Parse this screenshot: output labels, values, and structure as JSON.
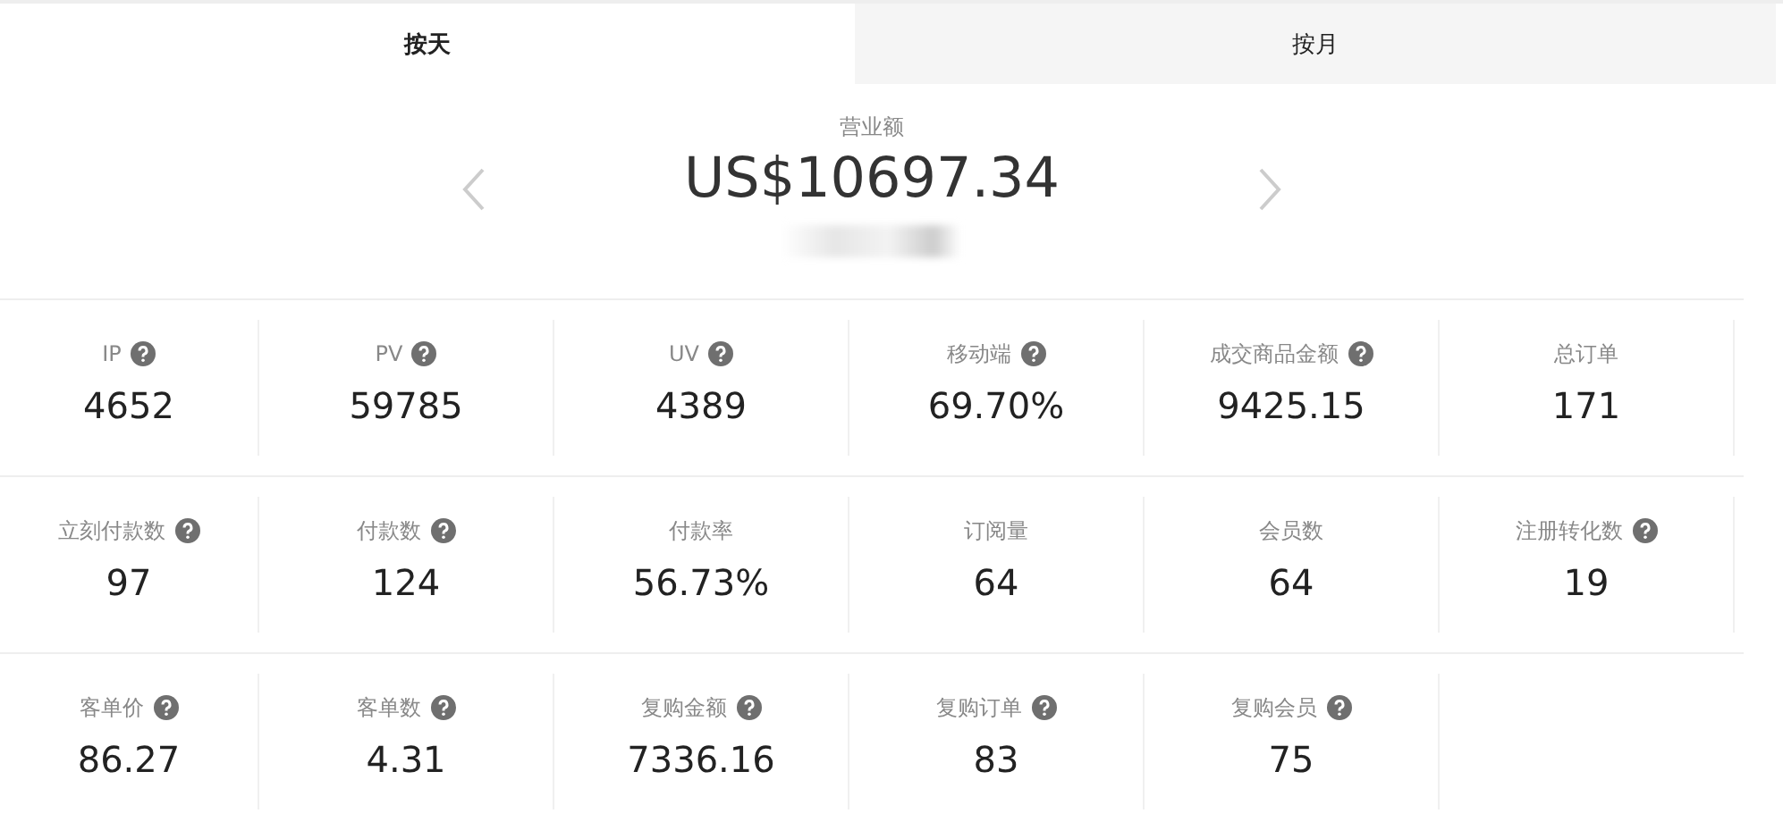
{
  "tabs": [
    {
      "label": "按天",
      "selected": true
    },
    {
      "label": "按月",
      "selected": false
    }
  ],
  "summary": {
    "label": "营业额",
    "value": "US$10697.34"
  },
  "metric_rows": [
    [
      {
        "label": "IP",
        "help": true,
        "value": "4652"
      },
      {
        "label": "PV",
        "help": true,
        "value": "59785"
      },
      {
        "label": "UV",
        "help": true,
        "value": "4389"
      },
      {
        "label": "移动端",
        "help": true,
        "value": "69.70%"
      },
      {
        "label": "成交商品金额",
        "help": true,
        "value": "9425.15"
      },
      {
        "label": "总订单",
        "help": false,
        "value": "171"
      }
    ],
    [
      {
        "label": "立刻付款数",
        "help": true,
        "value": "97"
      },
      {
        "label": "付款数",
        "help": true,
        "value": "124"
      },
      {
        "label": "付款率",
        "help": false,
        "value": "56.73%"
      },
      {
        "label": "订阅量",
        "help": false,
        "value": "64"
      },
      {
        "label": "会员数",
        "help": false,
        "value": "64"
      },
      {
        "label": "注册转化数",
        "help": true,
        "value": "19"
      }
    ],
    [
      {
        "label": "客单价",
        "help": true,
        "value": "86.27"
      },
      {
        "label": "客单数",
        "help": true,
        "value": "4.31"
      },
      {
        "label": "复购金额",
        "help": true,
        "value": "7336.16"
      },
      {
        "label": "复购订单",
        "help": true,
        "value": "83"
      },
      {
        "label": "复购会员",
        "help": true,
        "value": "75"
      }
    ]
  ]
}
